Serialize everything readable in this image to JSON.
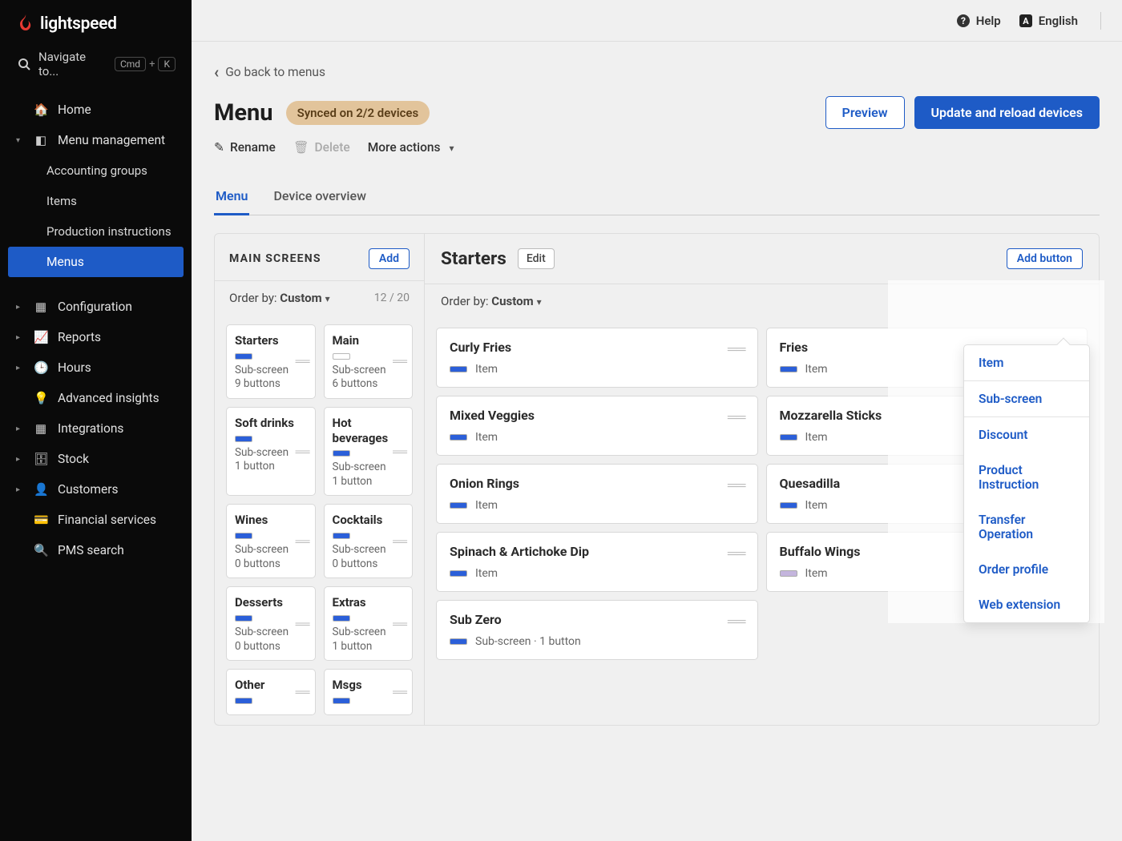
{
  "brand": "lightspeed",
  "search_placeholder": "Navigate to...",
  "kbd1": "Cmd",
  "kbd2": "K",
  "topbar": {
    "help": "Help",
    "lang": "English"
  },
  "back": "Go back to menus",
  "title": "Menu",
  "sync_badge": "Synced on 2/2 devices",
  "buttons": {
    "preview": "Preview",
    "update": "Update and reload devices",
    "rename": "Rename",
    "delete": "Delete",
    "more": "More actions"
  },
  "tabs": {
    "menu": "Menu",
    "device": "Device overview"
  },
  "left_panel": {
    "title": "MAIN SCREENS",
    "add": "Add",
    "order_label": "Order by:",
    "order_value": "Custom",
    "count": "12 / 20",
    "cards": [
      {
        "title": "Starters",
        "chip": "blue",
        "sub1": "Sub-screen",
        "sub2": "9 buttons"
      },
      {
        "title": "Main",
        "chip": "outline",
        "sub1": "Sub-screen",
        "sub2": "6 buttons"
      },
      {
        "title": "Soft drinks",
        "chip": "blue",
        "sub1": "Sub-screen",
        "sub2": "1 button"
      },
      {
        "title": "Hot beverages",
        "chip": "blue",
        "sub1": "Sub-screen",
        "sub2": "1 button"
      },
      {
        "title": "Wines",
        "chip": "blue",
        "sub1": "Sub-screen",
        "sub2": "0 buttons"
      },
      {
        "title": "Cocktails",
        "chip": "blue",
        "sub1": "Sub-screen",
        "sub2": "0 buttons"
      },
      {
        "title": "Desserts",
        "chip": "blue",
        "sub1": "Sub-screen",
        "sub2": "0 buttons"
      },
      {
        "title": "Extras",
        "chip": "blue",
        "sub1": "Sub-screen",
        "sub2": "1 button"
      },
      {
        "title": "Other",
        "chip": "blue",
        "sub1": "",
        "sub2": ""
      },
      {
        "title": "Msgs",
        "chip": "blue",
        "sub1": "",
        "sub2": ""
      }
    ]
  },
  "right_panel": {
    "title": "Starters",
    "edit": "Edit",
    "add_button": "Add button",
    "order_label": "Order by:",
    "order_value": "Custom",
    "items_left": [
      {
        "title": "Curly Fries",
        "type": "Item",
        "chip": "blue"
      },
      {
        "title": "Mixed Veggies",
        "type": "Item",
        "chip": "blue"
      },
      {
        "title": "Onion Rings",
        "type": "Item",
        "chip": "blue"
      },
      {
        "title": "Spinach & Artichoke Dip",
        "type": "Item",
        "chip": "blue"
      },
      {
        "title": "Sub Zero",
        "type": "Sub-screen · 1 button",
        "chip": "blue"
      }
    ],
    "items_right": [
      {
        "title": "Fries",
        "type": "Item",
        "chip": "blue"
      },
      {
        "title": "Mozzarella Sticks",
        "type": "Item",
        "chip": "blue"
      },
      {
        "title": "Quesadilla",
        "type": "Item",
        "chip": "blue"
      },
      {
        "title": "Buffalo Wings",
        "type": "Item",
        "chip": "faded"
      }
    ]
  },
  "dropdown": [
    "Item",
    "Sub-screen",
    "Discount",
    "Product Instruction",
    "Transfer Operation",
    "Order profile",
    "Web extension"
  ],
  "nav": {
    "home": "Home",
    "menu_mgmt": "Menu management",
    "accounting": "Accounting groups",
    "items": "Items",
    "prod": "Production instructions",
    "menus": "Menus",
    "config": "Configuration",
    "reports": "Reports",
    "hours": "Hours",
    "insights": "Advanced insights",
    "integrations": "Integrations",
    "stock": "Stock",
    "customers": "Customers",
    "financial": "Financial services",
    "pms": "PMS search"
  }
}
